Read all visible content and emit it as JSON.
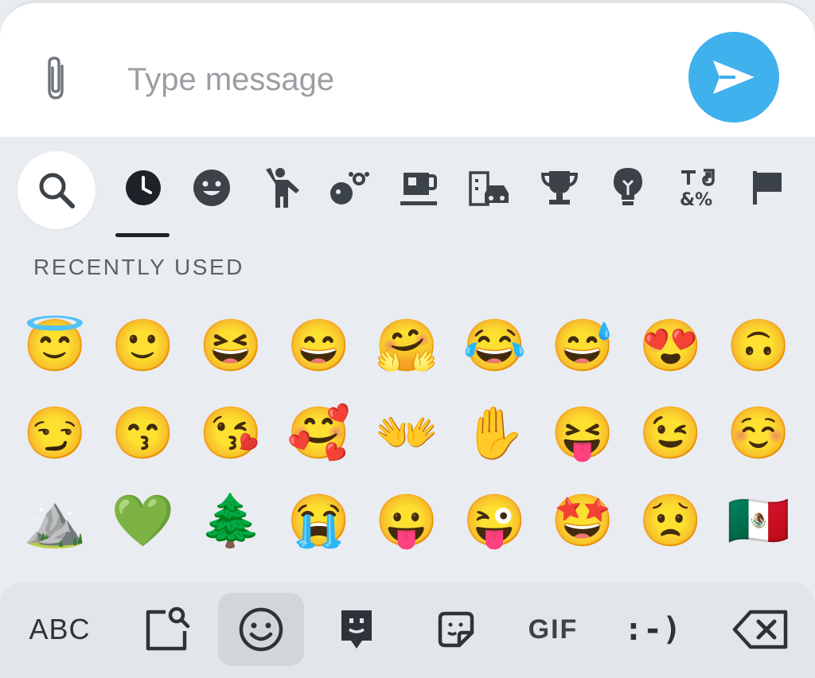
{
  "compose": {
    "placeholder": "Type message",
    "attach_icon": "paperclip-icon",
    "send_icon": "send-icon",
    "send_color": "#3fb1ec"
  },
  "categories": [
    {
      "id": "search",
      "icon": "search-icon"
    },
    {
      "id": "recent",
      "icon": "clock-icon",
      "active": true
    },
    {
      "id": "smileys",
      "icon": "smiley-icon"
    },
    {
      "id": "people",
      "icon": "person-waving-icon"
    },
    {
      "id": "nature",
      "icon": "nature-icon"
    },
    {
      "id": "food",
      "icon": "coffee-cup-icon"
    },
    {
      "id": "travel",
      "icon": "building-car-icon"
    },
    {
      "id": "activities",
      "icon": "trophy-icon"
    },
    {
      "id": "objects",
      "icon": "lightbulb-icon"
    },
    {
      "id": "symbols",
      "icon": "symbols-icon"
    },
    {
      "id": "flags",
      "icon": "flag-icon"
    }
  ],
  "section": {
    "title": "RECENTLY USED"
  },
  "emojis": [
    "😇",
    "🙂",
    "😆",
    "😄",
    "🤗",
    "😂",
    "😅",
    "😍",
    "🙃",
    "😏",
    "😙",
    "😘",
    "🥰",
    "👐",
    "✋",
    "😝",
    "😉",
    "☺️",
    "⛰️",
    "💚",
    "🌲",
    "😭",
    "😛",
    "😜",
    "🤩",
    "😟",
    "🇲🇽"
  ],
  "toolbar": {
    "abc_label": "ABC",
    "gif_label": "GIF",
    "emoticon_label": ":-)",
    "active_item": "emoji"
  }
}
